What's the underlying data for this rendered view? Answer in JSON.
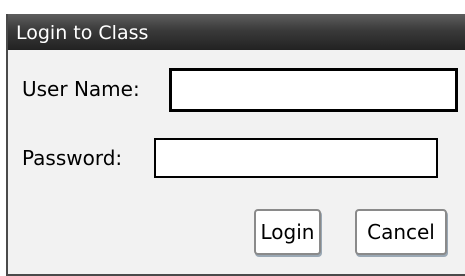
{
  "dialog": {
    "title": "Login to Class",
    "fields": {
      "username": {
        "label": "User Name:",
        "value": "",
        "placeholder": ""
      },
      "password": {
        "label": "Password:",
        "value": "",
        "placeholder": ""
      }
    },
    "buttons": {
      "login": "Login",
      "cancel": "Cancel"
    }
  },
  "colors": {
    "titlebar_top": "#5e5e5e",
    "titlebar_bottom": "#222222",
    "dialog_background": "#f2f2f2",
    "title_text": "#ffffff"
  }
}
